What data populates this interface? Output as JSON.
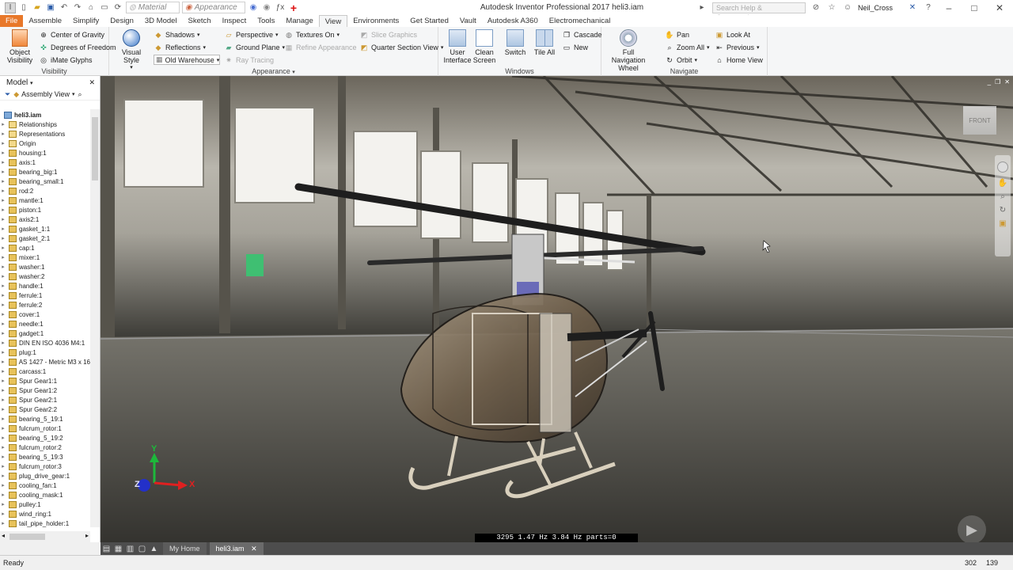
{
  "title_bar": {
    "window_title": "Autodesk Inventor Professional 2017    heli3.iam",
    "material_combo": "Material",
    "appearance_combo": "Appearance",
    "search_placeholder": "Search Help & Commands...",
    "user_name": "Neil_Cross"
  },
  "ribbon_tabs": [
    "File",
    "Assemble",
    "Simplify",
    "Design",
    "3D Model",
    "Sketch",
    "Inspect",
    "Tools",
    "Manage",
    "View",
    "Environments",
    "Get Started",
    "Vault",
    "Autodesk A360",
    "Electromechanical"
  ],
  "active_tab": "View",
  "ribbon": {
    "visibility": {
      "title": "Visibility",
      "object_visibility": "Object Visibility",
      "center_of_gravity": "Center of Gravity",
      "degrees_of_freedom": "Degrees of Freedom",
      "imate_glyphs": "iMate Glyphs"
    },
    "appearance": {
      "title": "Appearance",
      "visual_style": "Visual Style",
      "shadows": "Shadows",
      "reflections": "Reflections",
      "environment": "Old Warehouse",
      "perspective": "Perspective",
      "ground_plane": "Ground Plane",
      "ray_tracing": "Ray Tracing",
      "textures_on": "Textures On",
      "refine_appearance": "Refine Appearance",
      "slice_graphics": "Slice Graphics",
      "quarter_section_view": "Quarter Section View"
    },
    "windows": {
      "title": "Windows",
      "user_interface": "User Interface",
      "clean_screen": "Clean Screen",
      "switch": "Switch",
      "tile_all": "Tile All",
      "cascade": "Cascade",
      "new": "New"
    },
    "navigate": {
      "title": "Navigate",
      "full_navigation_wheel": "Full Navigation Wheel",
      "pan": "Pan",
      "zoom_all": "Zoom All",
      "orbit": "Orbit",
      "look_at": "Look At",
      "previous": "Previous",
      "home_view": "Home View"
    }
  },
  "browser": {
    "title": "Model",
    "view_mode": "Assembly View",
    "root": "heli3.iam",
    "items": [
      "Relationships",
      "Representations",
      "Origin",
      "housing:1",
      "axis:1",
      "bearing_big:1",
      "bearing_small:1",
      "rod:2",
      "mantle:1",
      "piston:1",
      "axis2:1",
      "gasket_1:1",
      "gasket_2:1",
      "cap:1",
      "mixer:1",
      "washer:1",
      "washer:2",
      "handle:1",
      "ferrule:1",
      "ferrule:2",
      "cover:1",
      "needle:1",
      "gadget:1",
      "DIN EN ISO 4036 M4:1",
      "plug:1",
      "AS 1427 - Metric M3 x 16",
      "carcass:1",
      "Spur Gear1:1",
      "Spur Gear1:2",
      "Spur Gear2:1",
      "Spur Gear2:2",
      "bearing_5_19:1",
      "fulcrum_rotor:1",
      "bearing_5_19:2",
      "fulcrum_rotor:2",
      "bearing_5_19:3",
      "fulcrum_rotor:3",
      "plug_drive_gear:1",
      "cooling_fan:1",
      "cooling_mask:1",
      "pulley:1",
      "wind_ring:1",
      "tail_pipe_holder:1"
    ]
  },
  "viewport": {
    "stats": "3295  1.47 Hz  3.84 Hz  parts=0 triangles=0.0",
    "viewcube_label": "FRONT",
    "axis_x": "X",
    "axis_y": "Y",
    "axis_z": "Z"
  },
  "doc_tabs": {
    "home": "My Home",
    "document": "heli3.iam"
  },
  "status_bar": {
    "message": "Ready",
    "value_a": "302",
    "value_b": "139"
  }
}
